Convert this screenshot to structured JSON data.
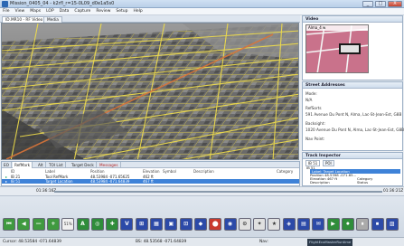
{
  "window": {
    "title": "Mission_0405_04 - k2rfl_r=15-0L09_d0e1a5s0",
    "controls": [
      "_",
      "□",
      "X"
    ]
  },
  "menu": [
    "File",
    "View",
    "Maps",
    "LOP",
    "Data",
    "Capture",
    "Review",
    "Setup",
    "Help"
  ],
  "map_tabs": [
    "ID.MR10 - RF Video",
    "Media"
  ],
  "video_panel": {
    "header": "Video",
    "thumb_label": "Alma_4 w"
  },
  "street_panel": {
    "header": "Street Addresses",
    "lines": [
      "Mode:",
      "N/A",
      "RefSorts",
      "591 Avenue Du Pont N, Alma, Lac-St-Jean-Est, G8B",
      "Backsight:",
      "1020 Avenue Du Pont N, Alma, Lac-St-Jean-Est, G8B",
      "Nav Point:"
    ]
  },
  "track_panel": {
    "header": "Track Inspector",
    "tabs": [
      "IB 51",
      "POI"
    ],
    "tree": [
      "IB 51",
      "Label: Target Location",
      "Position  48.5398  -071.65...",
      "Elevation  467 ft",
      "Description",
      "Category",
      "Status"
    ]
  },
  "list_tabs": [
    "EO",
    "RefMark",
    "Alt",
    "TOI List",
    "Target Deck",
    "Messages"
  ],
  "list": {
    "columns": [
      "ID",
      "Label",
      "Position",
      "Elevation",
      "Symbol",
      "Description",
      "Category"
    ],
    "rows": [
      [
        "IB 21",
        "Tool RefMark",
        "48.53984  -071.65625",
        "462 ft",
        "",
        "",
        ""
      ],
      [
        "IB 51",
        "Target Location",
        "48.53984  -071.64839",
        "467 ft",
        "",
        "",
        ""
      ]
    ]
  },
  "timeline": {
    "start": "01:36:16Z",
    "end": "01:36:21Z"
  },
  "toolbar_buttons": [
    "⏮",
    "◀",
    "—",
    "+",
    "51%",
    "A",
    "◎",
    "✚",
    "V",
    "⊞",
    "▦",
    "▣",
    "⊡",
    "◆",
    "⬤",
    "◉",
    "⊙",
    "✦",
    "★",
    "◈",
    "▤",
    "✉",
    "▶",
    "⏺",
    "⏸",
    "⏹",
    "▨"
  ],
  "status": {
    "cursor": "Cursor:  48.53584  -071.64839",
    "bs": "BS:  48.53568  -071.64839",
    "nav": "Nav:",
    "task": "FlightEcoMasterRuntime"
  },
  "colors": {
    "accent": "#3b7fd6",
    "selection": "#3e82d8",
    "road": "#f2df4a",
    "track": "#d8743a"
  }
}
